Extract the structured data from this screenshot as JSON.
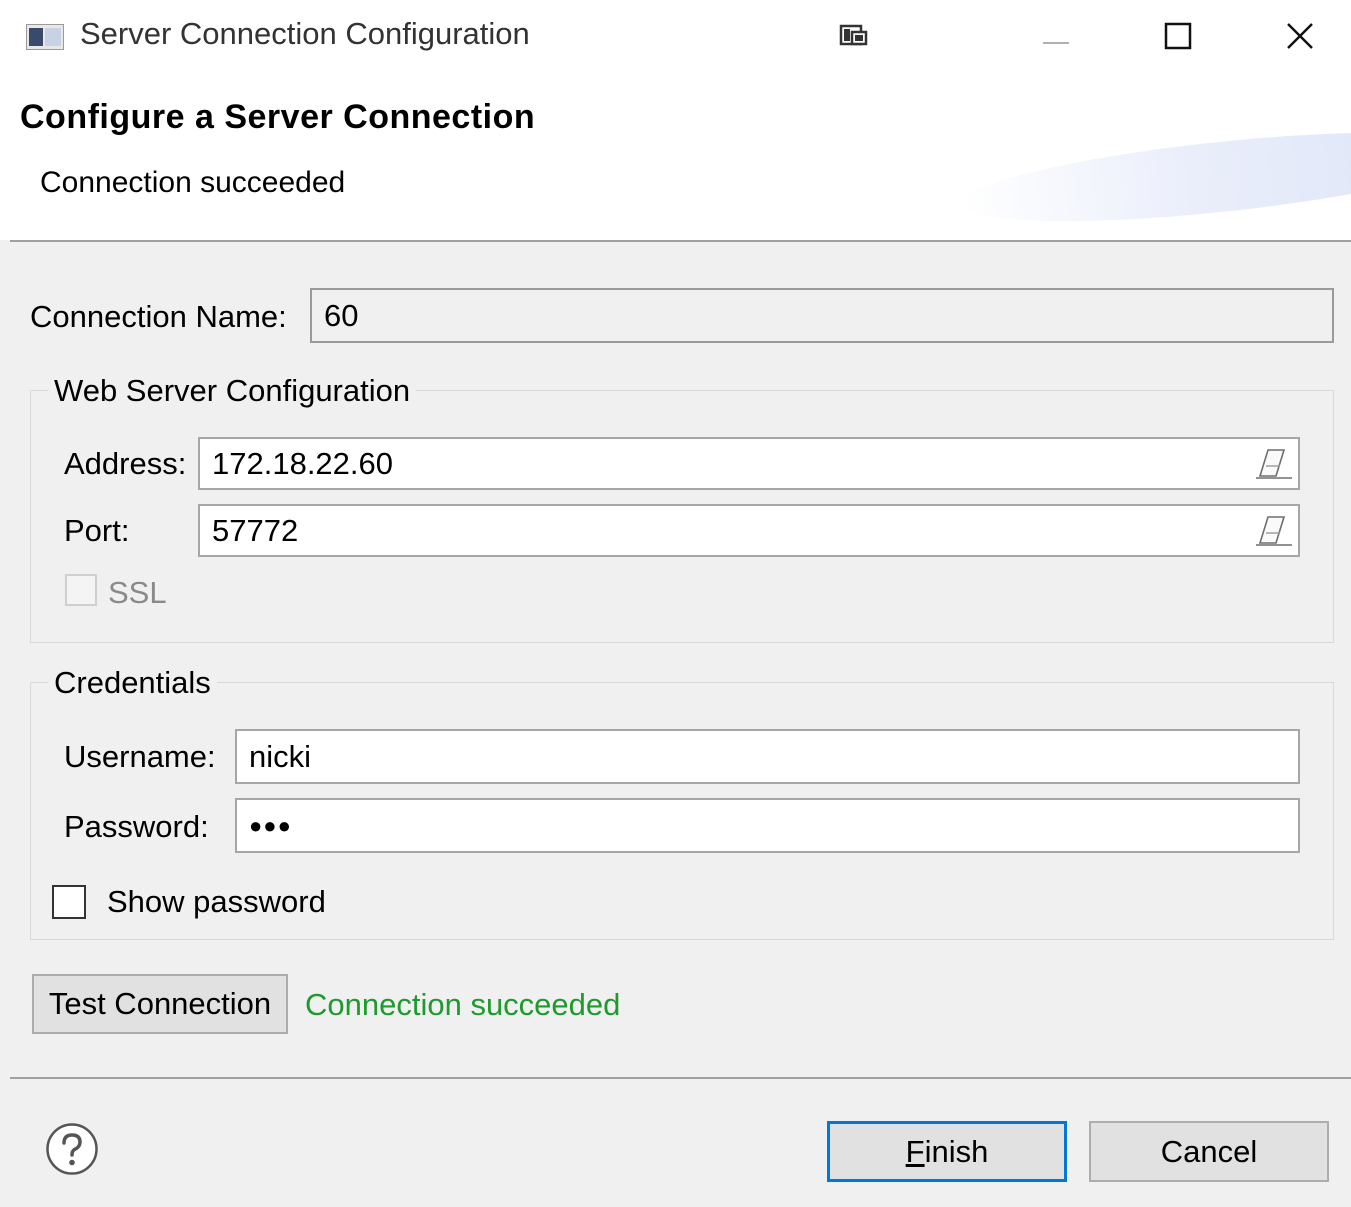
{
  "window": {
    "title": "Server Connection Configuration",
    "icons": [
      "app-icon",
      "restore-window-icon",
      "minimize-icon",
      "maximize-icon",
      "close-icon"
    ]
  },
  "banner": {
    "title": "Configure a Server Connection",
    "message": "Connection succeeded"
  },
  "connection": {
    "label": "Connection Name:",
    "value": "60"
  },
  "web_server": {
    "group_title": "Web Server Configuration",
    "address_label": "Address:",
    "address_value": "172.18.22.60",
    "port_label": "Port:",
    "port_value": "57772",
    "ssl_label": "SSL",
    "ssl_checked": false,
    "ssl_enabled": false
  },
  "credentials": {
    "group_title": "Credentials",
    "username_label": "Username:",
    "username_value": "nicki",
    "password_label": "Password:",
    "password_mask": "●●●",
    "show_password_label": "Show password",
    "show_password_checked": false
  },
  "test": {
    "button_label": "Test Connection",
    "status": "Connection succeeded",
    "status_color": "#1f9a2e"
  },
  "footer": {
    "finish_mnemonic": "F",
    "finish_rest": "inish",
    "cancel_label": "Cancel"
  },
  "colors": {
    "accent": "#0078d7"
  }
}
